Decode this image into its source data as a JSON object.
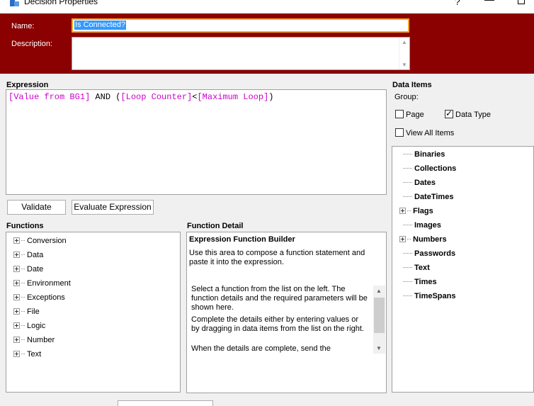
{
  "window": {
    "title": "Decision Properties",
    "help_glyph": "?",
    "minimize_glyph": "—"
  },
  "header": {
    "name_label": "Name:",
    "name_value": "Is Connected?",
    "description_label": "Description:",
    "description_value": ""
  },
  "expression": {
    "label": "Expression",
    "tokens": [
      {
        "text": "[Value from BG1]",
        "kind": "pink"
      },
      {
        "text": " AND (",
        "kind": "blk"
      },
      {
        "text": "[Loop Counter]",
        "kind": "pink"
      },
      {
        "text": "<",
        "kind": "blk"
      },
      {
        "text": "[Maximum Loop]",
        "kind": "pink"
      },
      {
        "text": ")",
        "kind": "blk"
      }
    ]
  },
  "buttons": {
    "validate": "Validate",
    "evaluate": "Evaluate Expression"
  },
  "functions": {
    "label": "Functions",
    "items": [
      "Conversion",
      "Data",
      "Date",
      "Environment",
      "Exceptions",
      "File",
      "Logic",
      "Number",
      "Text"
    ]
  },
  "function_detail": {
    "label": "Function Detail",
    "title": "Expression Function Builder",
    "intro": "Use this area to compose a function statement and paste it into the expression.",
    "help_1": "Select a function from the list on the left. The function details and the required parameters will be shown here.",
    "help_2": "Complete the details either by entering values or by dragging in data items from the list on the right.",
    "help_3": "When the details are complete, send the"
  },
  "data_items": {
    "label": "Data Items",
    "group_label": "Group:",
    "page_label": "Page",
    "page_checked": false,
    "data_type_label": "Data Type",
    "data_type_checked": true,
    "view_all_label": "View All Items",
    "view_all_checked": false,
    "items": [
      {
        "label": "Binaries",
        "expandable": false
      },
      {
        "label": "Collections",
        "expandable": false
      },
      {
        "label": "Dates",
        "expandable": false
      },
      {
        "label": "DateTimes",
        "expandable": false
      },
      {
        "label": "Flags",
        "expandable": true
      },
      {
        "label": "Images",
        "expandable": false
      },
      {
        "label": "Numbers",
        "expandable": true
      },
      {
        "label": "Passwords",
        "expandable": false
      },
      {
        "label": "Text",
        "expandable": false
      },
      {
        "label": "Times",
        "expandable": false
      },
      {
        "label": "TimeSpans",
        "expandable": false
      }
    ]
  },
  "colors": {
    "header_bg": "#8b0000",
    "token_highlight": "#cc00cc",
    "focus_border": "#f5a623",
    "selection": "#3399ff"
  }
}
